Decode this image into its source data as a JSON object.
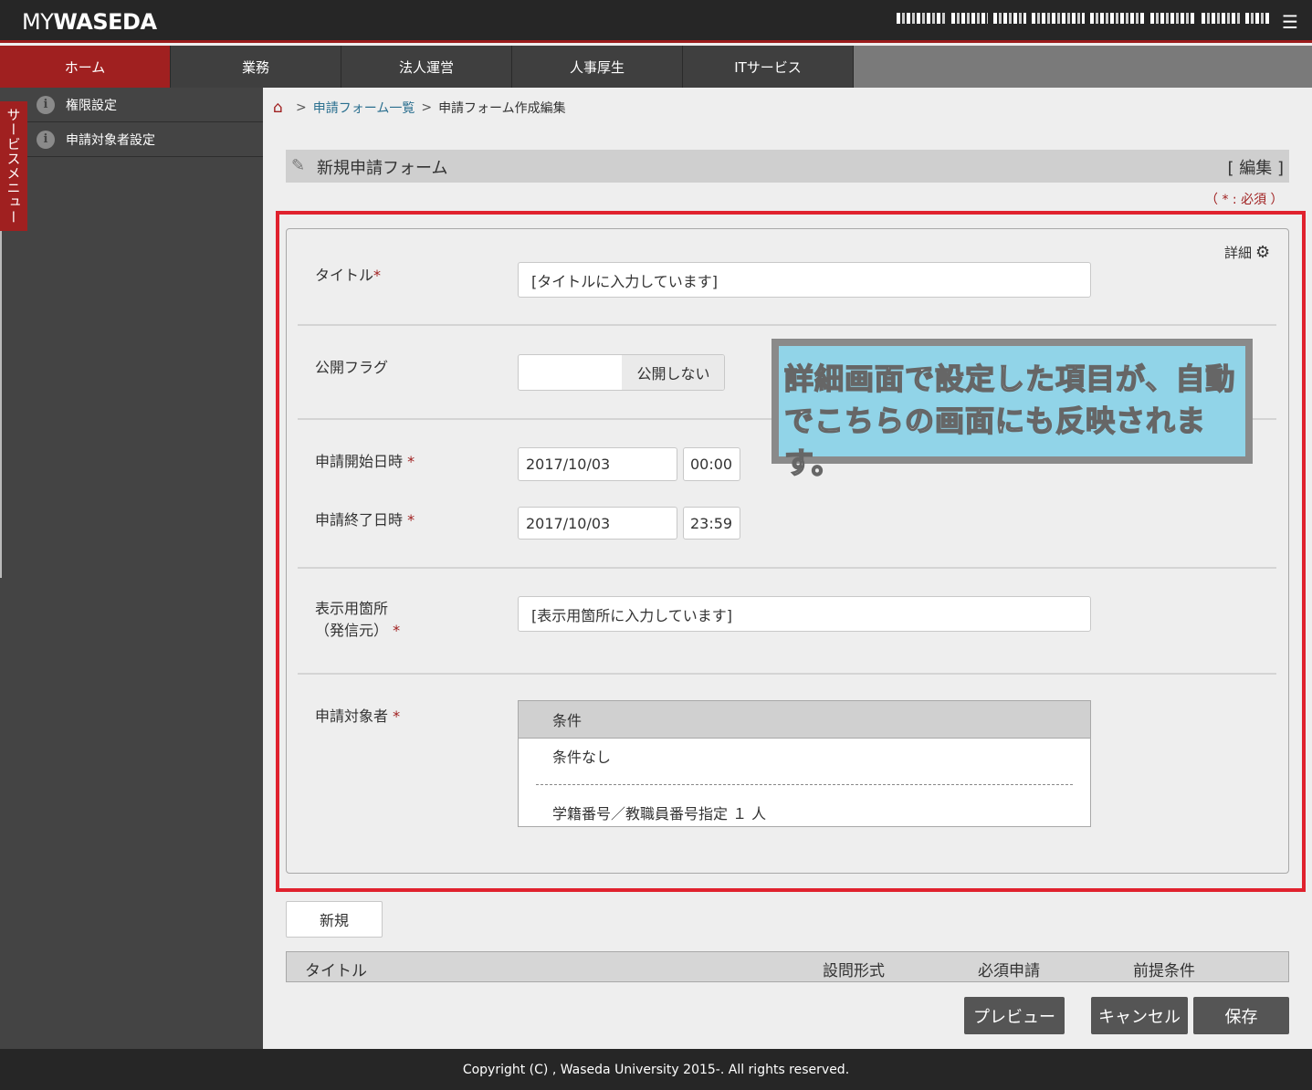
{
  "header": {
    "logo_my": "MY",
    "logo_waseda": "WASEDA",
    "menu_icon": "menu-icon"
  },
  "nav": {
    "tabs": [
      "ホーム",
      "業務",
      "法人運営",
      "人事厚生",
      "ITサービス"
    ],
    "active_index": 0
  },
  "sidebar": {
    "service_menu_label": "サービスメニュー",
    "items": [
      {
        "label": "権限設定",
        "icon": "info-icon"
      },
      {
        "label": "申請対象者設定",
        "icon": "info-icon"
      }
    ]
  },
  "breadcrumb": {
    "link": "申請フォーム一覧",
    "separator": ">",
    "current": "申請フォーム作成編集"
  },
  "section": {
    "title": "新規申請フォーム",
    "edit_label": "[ 編集 ]",
    "required_note": "（ * : 必須 ）"
  },
  "form": {
    "detail_label": "詳細",
    "title_label": "タイトル",
    "title_value": "[タイトルに入力しています]",
    "publish_label": "公開フラグ",
    "publish_value": "公開しない",
    "start_label": "申請開始日時",
    "start_date": "2017/10/03",
    "start_time": "00:00",
    "end_label": "申請終了日時",
    "end_date": "2017/10/03",
    "end_time": "23:59",
    "display_label_1": "表示用箇所",
    "display_label_2": "（発信元）",
    "display_value": "[表示用箇所に入力しています]",
    "target_label": "申請対象者",
    "asterisk": "*",
    "conditions": {
      "header": "条件",
      "rows": [
        "条件なし",
        "学籍番号／教職員番号指定 １ 人"
      ]
    }
  },
  "callout": {
    "line1": "詳細画面で設定した項目が、自動",
    "line2": "でこちらの画面にも反映されます。"
  },
  "questions": {
    "new_button": "新規",
    "columns": [
      "タイトル",
      "設問形式",
      "必須申請",
      "前提条件"
    ]
  },
  "actions": {
    "preview": "プレビュー",
    "cancel": "キャンセル",
    "save": "保存"
  },
  "footer": {
    "copyright": "Copyright (C) , Waseda University 2015-. All rights reserved."
  },
  "colors": {
    "brand_red": "#a02020",
    "highlight_red": "#e0222e",
    "callout_blue": "#91d4e8"
  }
}
